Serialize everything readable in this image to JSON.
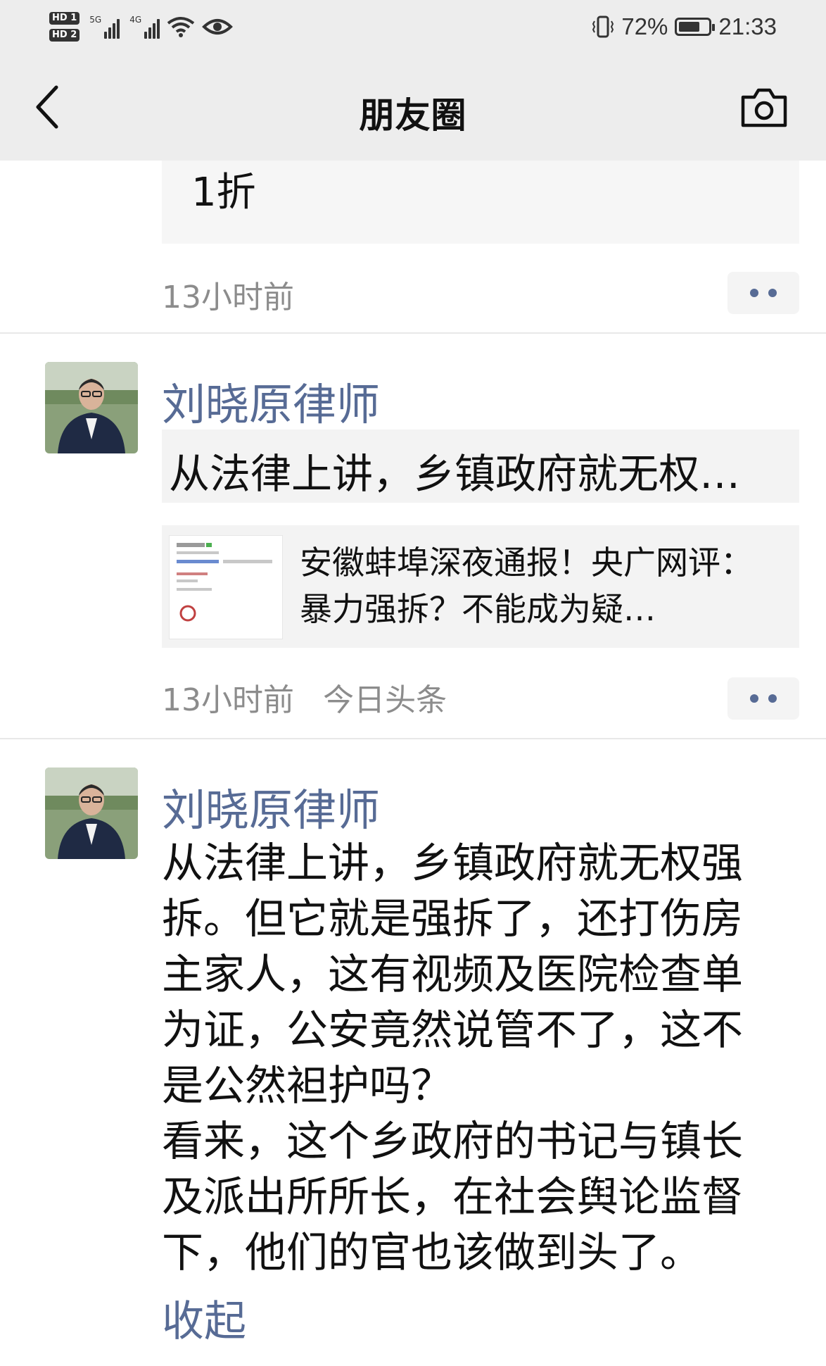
{
  "status_bar": {
    "badge_1": "HD 1",
    "badge_2": "HD 2",
    "network_1": "5G",
    "network_2": "4G",
    "battery_percent": "72%",
    "battery_level": 0.72,
    "time": "21:33",
    "icons": [
      "signal-icon",
      "wifi-icon",
      "eye-icon",
      "vibrate-icon",
      "battery-icon"
    ]
  },
  "nav": {
    "title": "朋友圈",
    "back_icon": "back-arrow-icon",
    "camera_icon": "camera-icon"
  },
  "colors": {
    "nav_background": "#ededed",
    "link_blue": "#576b95",
    "meta_gray": "#8c8c8c",
    "card_background": "#f3f3f3"
  },
  "feed": {
    "previous_item": {
      "text_fragment": "1折",
      "time": "13小时前"
    },
    "post_1": {
      "author": "刘晓原律师",
      "quote": "从法律上讲，乡镇政府就无权…",
      "link_title": "安徽蚌埠深夜通报！央广网评：暴力强拆？不能成为疑…",
      "time": "13小时前",
      "source": "今日头条"
    },
    "post_2": {
      "author": "刘晓原律师",
      "text": "从法律上讲，乡镇政府就无权强拆。但它就是强拆了，还打伤房主家人，这有视频及医院检查单为证，公安竟然说管不了，这不是公然袒护吗？\n看来，这个乡政府的书记与镇长及派出所所长，在社会舆论监督下，他们的官也该做到头了。",
      "collapse_label": "收起"
    }
  }
}
